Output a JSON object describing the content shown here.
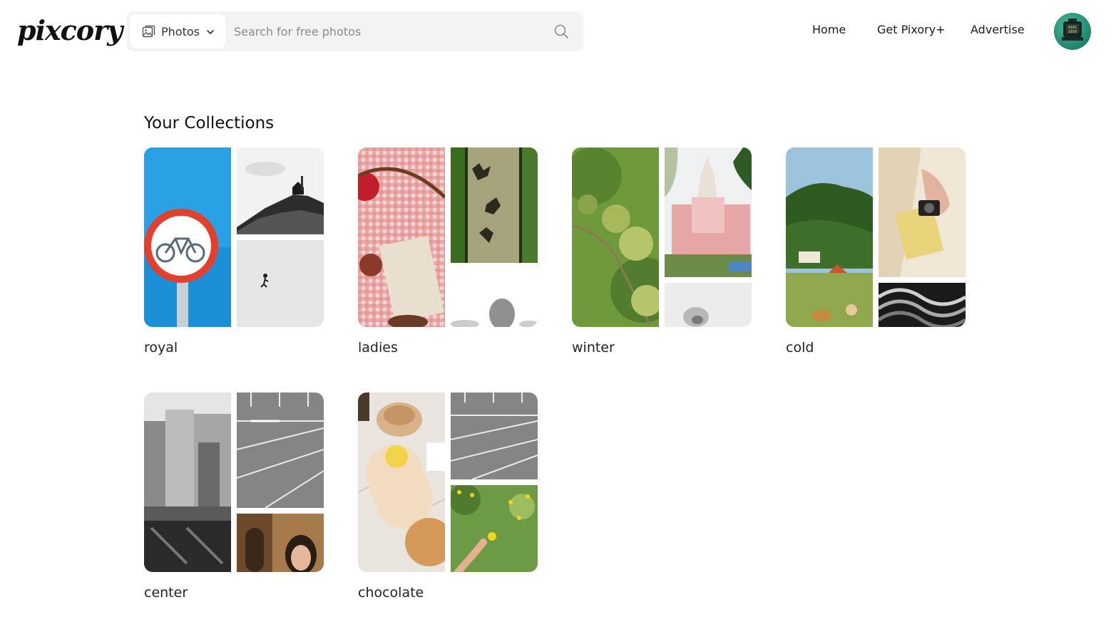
{
  "brand": {
    "logo_text": "pixcory"
  },
  "search": {
    "type_label": "Photos",
    "placeholder": "Search for free photos",
    "value": ""
  },
  "nav": {
    "home": "Home",
    "plus": "Get Pixory+",
    "advertise": "Advertise"
  },
  "avatar": {
    "icon": "computer-avatar-icon"
  },
  "main": {
    "title": "Your Collections",
    "collections": [
      {
        "name": "royal",
        "tiles": [
          "bicycle-sign",
          "lighthouse-hill",
          "person-snow"
        ]
      },
      {
        "name": "ladies",
        "tiles": [
          "picnic-cloth",
          "leaf-shadow-tree",
          "blurred-figure"
        ]
      },
      {
        "name": "winter",
        "tiles": [
          "green-berries",
          "pink-temple",
          "bw-sketch"
        ]
      },
      {
        "name": "cold",
        "tiles": [
          "green-hills-village",
          "hands-camera",
          "bw-waves"
        ]
      },
      {
        "name": "center",
        "tiles": [
          "bw-city-buildings",
          "parking-lot-lines",
          "woman-portrait"
        ]
      },
      {
        "name": "chocolate",
        "tiles": [
          "cafe-table-dessert",
          "parking-lot-lines",
          "yellow-flowers-hand"
        ]
      }
    ]
  },
  "colors": {
    "search_bg": "#f3f3f3",
    "avatar_green": "#248c74",
    "text": "#1a1a1a"
  }
}
